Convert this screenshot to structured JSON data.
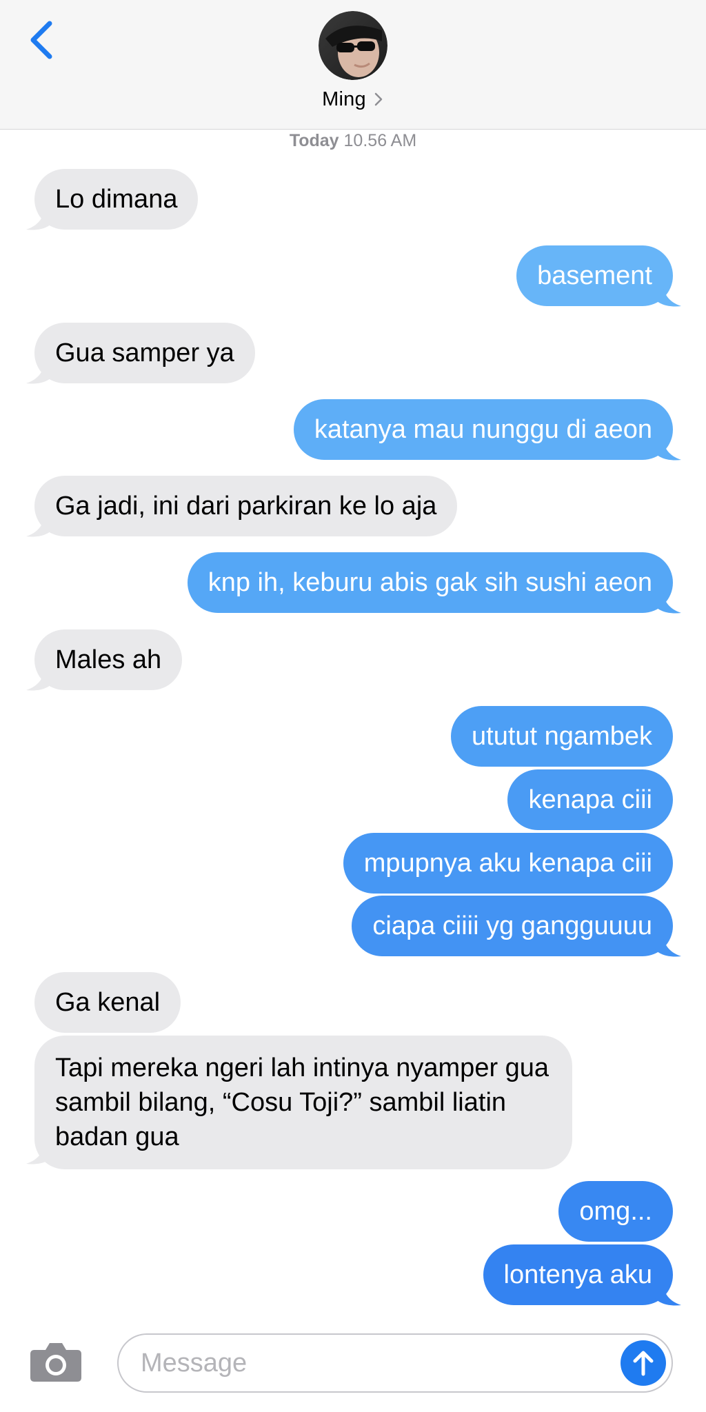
{
  "header": {
    "contact_name": "Ming"
  },
  "timestamp": {
    "day": "Today",
    "time": "10.56 AM"
  },
  "messages": [
    {
      "side": "received",
      "text": "Lo dimana"
    },
    {
      "side": "sent",
      "text": "basement"
    },
    {
      "side": "received",
      "text": "Gua samper ya"
    },
    {
      "side": "sent",
      "text": "katanya mau nunggu di aeon"
    },
    {
      "side": "received",
      "text": "Ga jadi, ini dari parkiran ke lo aja"
    },
    {
      "side": "sent",
      "text": "knp ih, keburu abis gak sih sushi aeon"
    },
    {
      "side": "received",
      "text": "Males ah"
    },
    {
      "side": "sent",
      "text": "ututut ngambek"
    },
    {
      "side": "sent",
      "text": "kenapa ciii"
    },
    {
      "side": "sent",
      "text": "mpupnya aku kenapa ciii"
    },
    {
      "side": "sent",
      "text": "ciapa ciiii yg gangguuuu"
    },
    {
      "side": "received",
      "text": "Ga kenal"
    },
    {
      "side": "received",
      "text": "Tapi mereka ngeri lah intinya nyamper gua sambil bilang, “Cosu Toji?” sambil liatin badan gua"
    },
    {
      "side": "sent",
      "text": "omg..."
    },
    {
      "side": "sent",
      "text": "lontenya aku"
    }
  ],
  "input": {
    "placeholder": "Message"
  },
  "colors": {
    "accent": "#1f7bf0",
    "received_bubble": "#e9e9eb",
    "sent_gradient_top": "#63b3f7",
    "sent_gradient_bottom": "#2f7ff0"
  },
  "icons": [
    "back-chevron-icon",
    "chevron-right-icon",
    "camera-icon",
    "send-arrow-icon"
  ]
}
